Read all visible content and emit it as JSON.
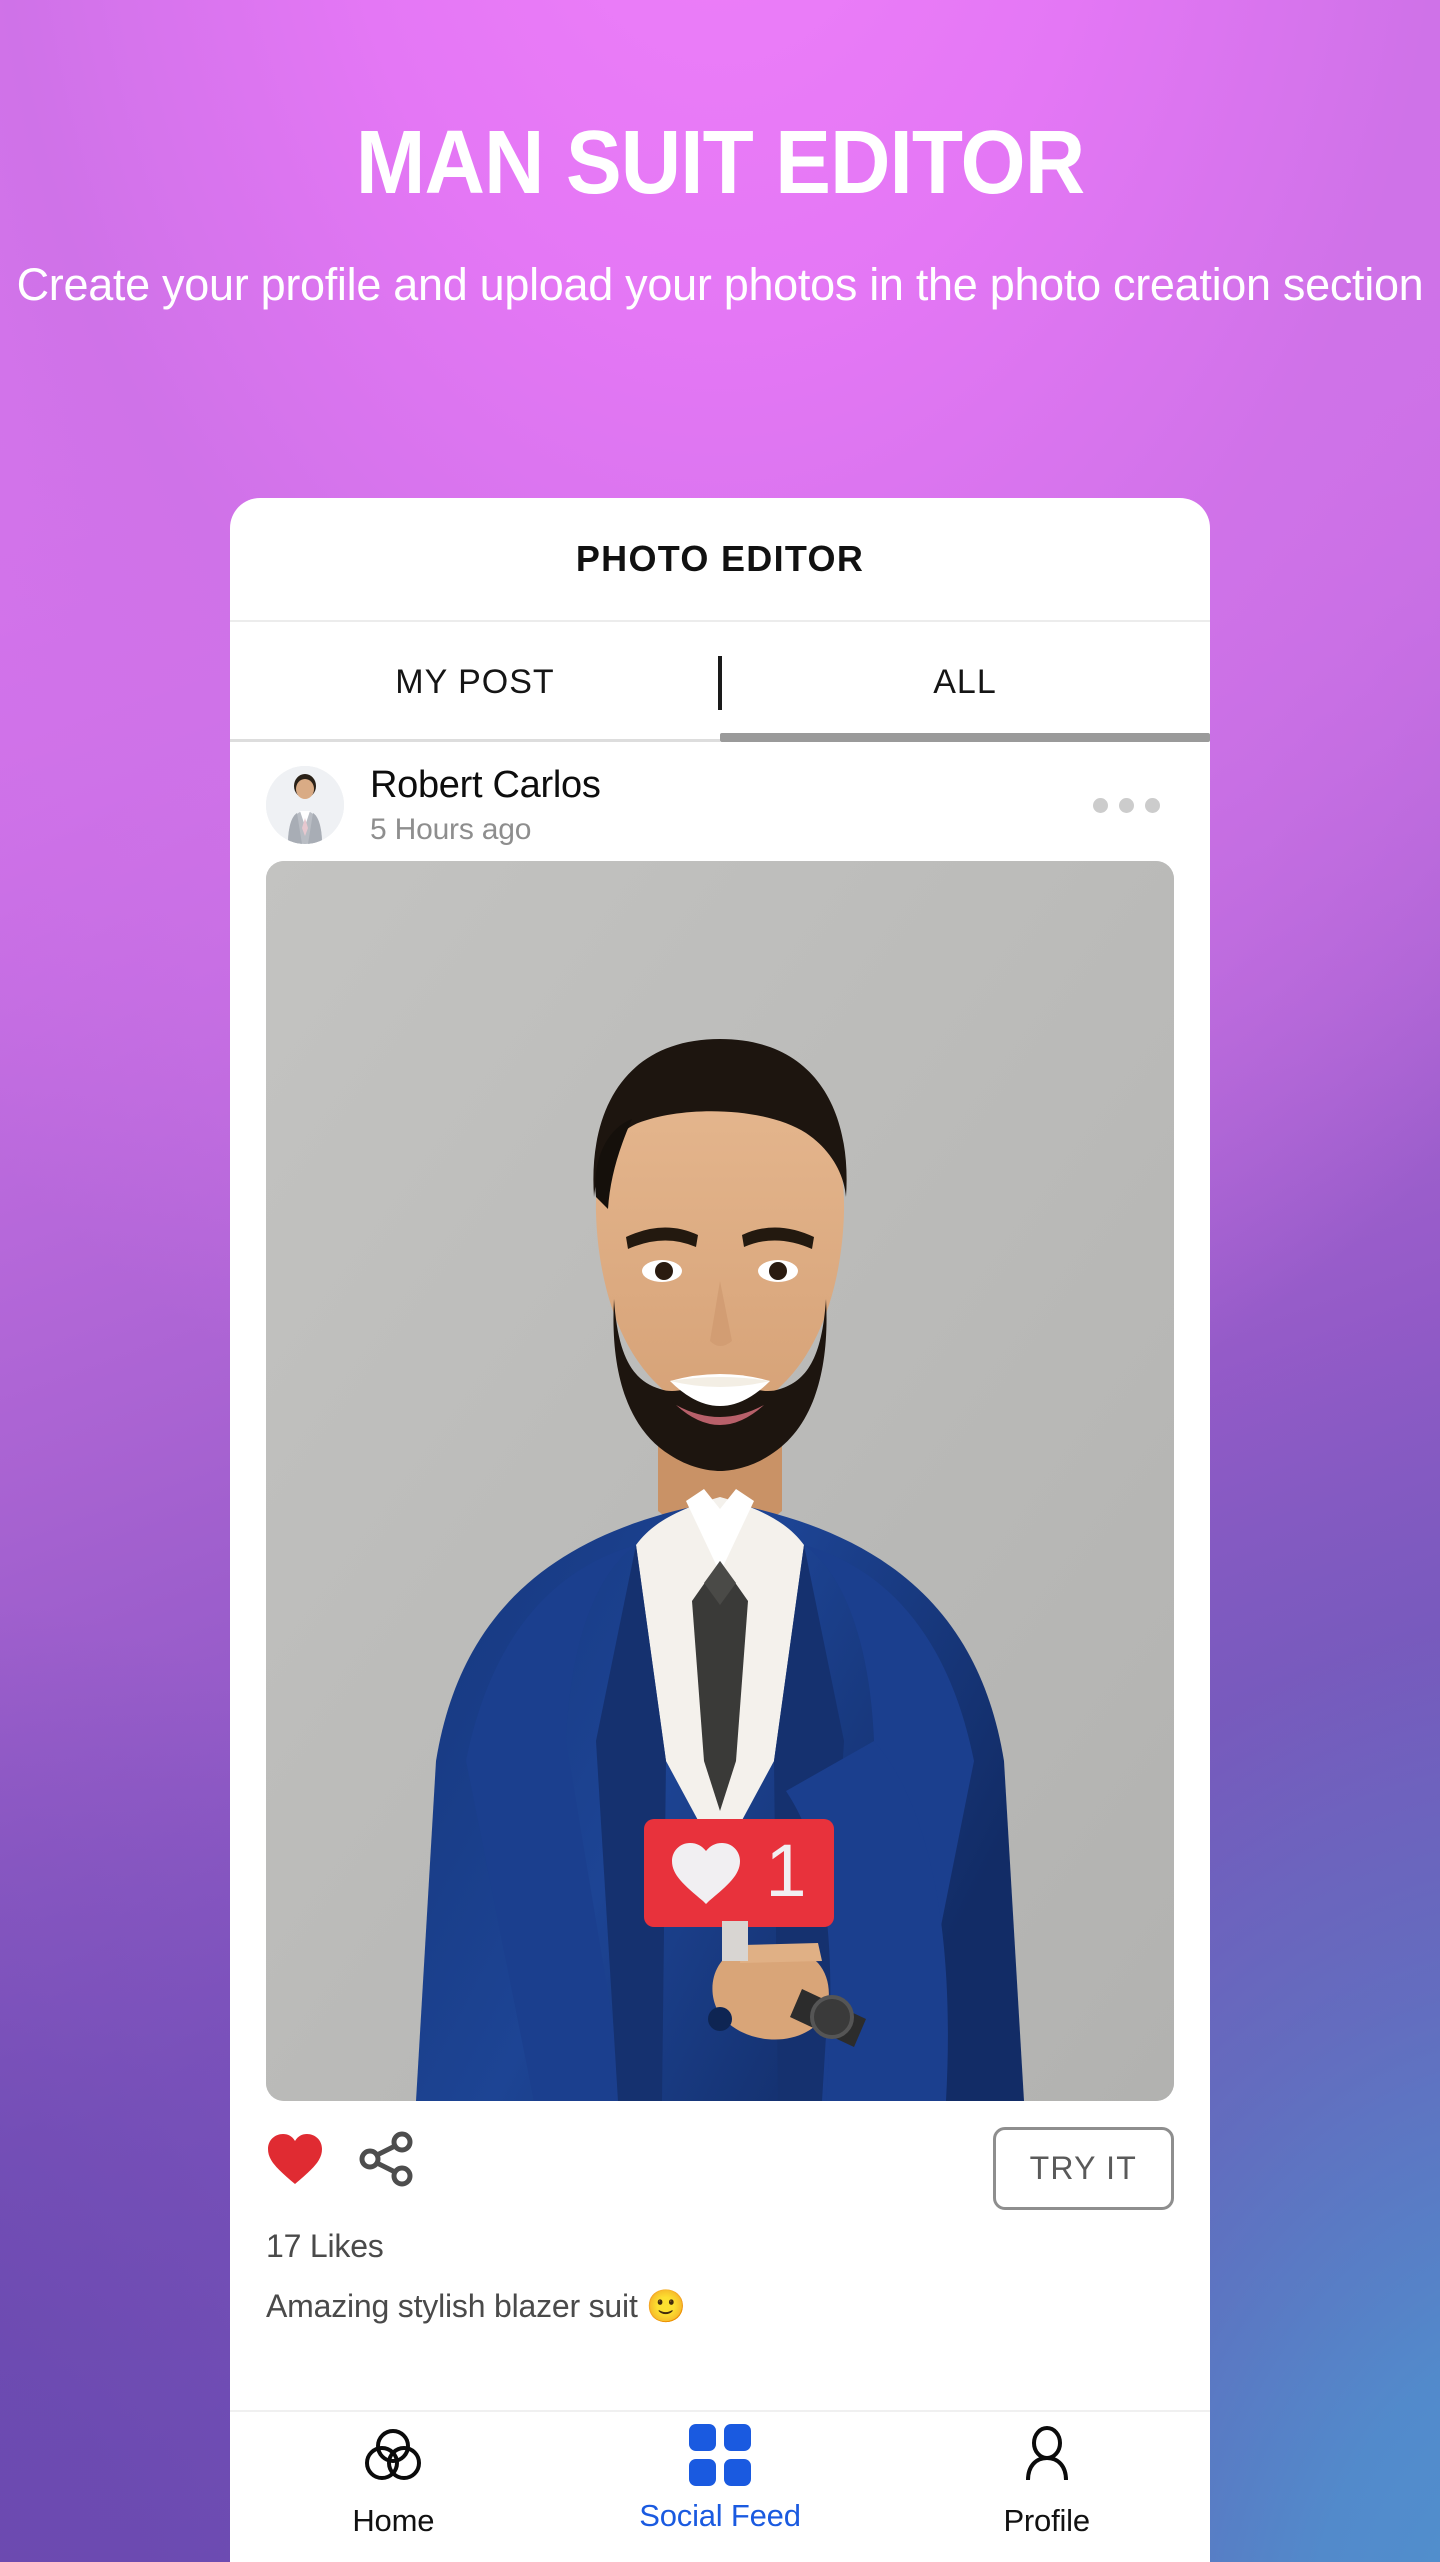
{
  "hero": {
    "title": "MAN SUIT EDITOR",
    "subtitle": "Create your profile and upload your photos in the photo creation section"
  },
  "app": {
    "title": "PHOTO EDITOR",
    "tabs": [
      {
        "label": "MY POST",
        "active": false
      },
      {
        "label": "ALL",
        "active": true
      }
    ]
  },
  "post": {
    "author": "Robert Carlos",
    "time": "5 Hours ago",
    "more_icon": "more-horizontal-icon",
    "avatar_icon": "user-avatar-photo",
    "photo_icon": "man-in-navy-suit-photo",
    "like_icon": "heart-filled-icon",
    "share_icon": "share-icon",
    "try_label": "TRY IT",
    "likes": "17 Likes",
    "caption": "Amazing stylish blazer suit 🙂",
    "overlay_count": "1"
  },
  "nav": {
    "items": [
      {
        "label": "Home",
        "icon": "three-circles-icon",
        "active": false
      },
      {
        "label": "Social Feed",
        "icon": "grid-icon",
        "active": true
      },
      {
        "label": "Profile",
        "icon": "person-icon",
        "active": false
      }
    ]
  },
  "colors": {
    "accent_blue": "#1a5ae0",
    "like_red": "#e02b32",
    "card_red": "#e8323c",
    "suit_navy": "#16367a",
    "bg_magenta": "#ea79f6",
    "bg_purple": "#6849ae",
    "bg_blue": "#5189c5"
  }
}
